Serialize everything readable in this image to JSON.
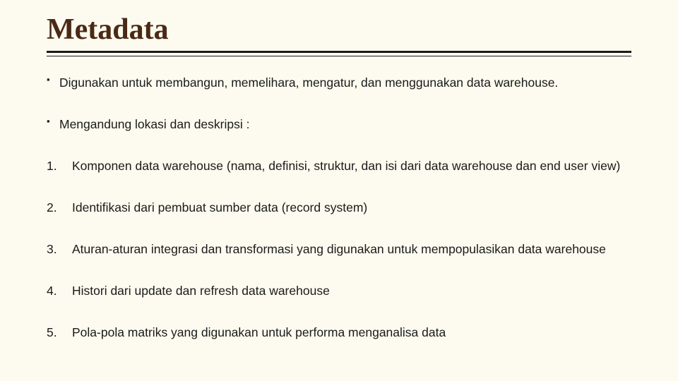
{
  "title": "Metadata",
  "bullets": [
    "Digunakan untuk membangun, memelihara, mengatur, dan menggunakan data warehouse.",
    "Mengandung lokasi dan deskripsi :"
  ],
  "numbered": [
    "Komponen data warehouse (nama, definisi, struktur, dan isi dari data warehouse dan end user view)",
    "Identifikasi dari pembuat sumber data (record system)",
    "Aturan-aturan integrasi dan transformasi yang digunakan untuk mempopulasikan data warehouse",
    "Histori dari update dan refresh data warehouse",
    "Pola-pola matriks yang digunakan untuk performa menganalisa data"
  ]
}
